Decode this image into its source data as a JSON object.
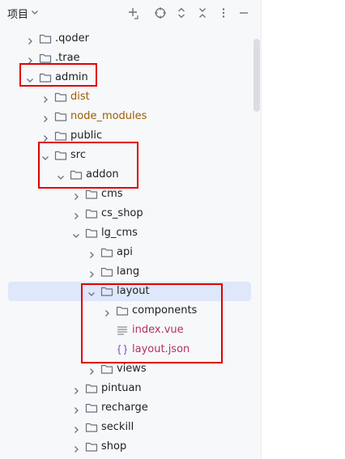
{
  "header": {
    "title": "项目",
    "icons": [
      "chevron-down-icon",
      "new-item-icon",
      "locate-icon",
      "expand-all-icon",
      "collapse-all-icon",
      "more-icon",
      "minimize-icon"
    ]
  },
  "colors": {
    "default_text": "#1f1f1f",
    "excluded_text": "#9c5d00",
    "file_text": "#b2325c",
    "selection_bg": "#dfe7fb",
    "highlight_border": "#e00000"
  },
  "tree": [
    {
      "label": ".qoder",
      "depth": 1,
      "expanded": false,
      "kind": "folder",
      "tone": "default"
    },
    {
      "label": ".trae",
      "depth": 1,
      "expanded": false,
      "kind": "folder",
      "tone": "default"
    },
    {
      "label": "admin",
      "depth": 1,
      "expanded": true,
      "kind": "folder",
      "tone": "default"
    },
    {
      "label": "dist",
      "depth": 2,
      "expanded": false,
      "kind": "folder",
      "tone": "excluded"
    },
    {
      "label": "node_modules",
      "depth": 2,
      "expanded": false,
      "kind": "folder",
      "tone": "excluded"
    },
    {
      "label": "public",
      "depth": 2,
      "expanded": false,
      "kind": "folder",
      "tone": "default"
    },
    {
      "label": "src",
      "depth": 2,
      "expanded": true,
      "kind": "folder",
      "tone": "default"
    },
    {
      "label": "addon",
      "depth": 3,
      "expanded": true,
      "kind": "folder",
      "tone": "default"
    },
    {
      "label": "cms",
      "depth": 4,
      "expanded": false,
      "kind": "folder",
      "tone": "default"
    },
    {
      "label": "cs_shop",
      "depth": 4,
      "expanded": false,
      "kind": "folder",
      "tone": "default"
    },
    {
      "label": "lg_cms",
      "depth": 4,
      "expanded": true,
      "kind": "folder",
      "tone": "default"
    },
    {
      "label": "api",
      "depth": 5,
      "expanded": false,
      "kind": "folder",
      "tone": "default"
    },
    {
      "label": "lang",
      "depth": 5,
      "expanded": false,
      "kind": "folder",
      "tone": "default"
    },
    {
      "label": "layout",
      "depth": 5,
      "expanded": true,
      "kind": "folder",
      "tone": "default",
      "selected": true
    },
    {
      "label": "components",
      "depth": 6,
      "expanded": false,
      "kind": "folder",
      "tone": "default"
    },
    {
      "label": "index.vue",
      "depth": 6,
      "kind": "vue-file",
      "tone": "file"
    },
    {
      "label": "layout.json",
      "depth": 6,
      "kind": "json-file",
      "tone": "file"
    },
    {
      "label": "views",
      "depth": 5,
      "expanded": false,
      "kind": "folder",
      "tone": "default"
    },
    {
      "label": "pintuan",
      "depth": 4,
      "expanded": false,
      "kind": "folder",
      "tone": "default"
    },
    {
      "label": "recharge",
      "depth": 4,
      "expanded": false,
      "kind": "folder",
      "tone": "default"
    },
    {
      "label": "seckill",
      "depth": 4,
      "expanded": false,
      "kind": "folder",
      "tone": "default"
    },
    {
      "label": "shop",
      "depth": 4,
      "expanded": false,
      "kind": "folder",
      "tone": "default"
    }
  ]
}
